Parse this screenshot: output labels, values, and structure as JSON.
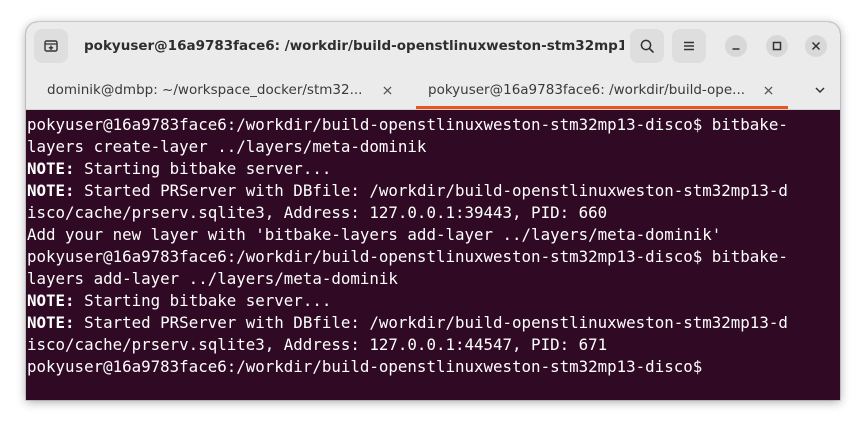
{
  "window": {
    "title": "pokyuser@16a9783face6: /workdir/build-openstlinuxweston-stm32mp13-..."
  },
  "tabs": [
    {
      "label": "dominik@dmbp: ~/workspace_docker/stm32...",
      "active": false
    },
    {
      "label": "pokyuser@16a9783face6: /workdir/build-ope...",
      "active": true
    }
  ],
  "colors": {
    "terminal_bg": "#300a24",
    "accent": "#e95420",
    "header_bg": "#ebebeb"
  },
  "icons": {
    "new_tab": "new-tab-icon",
    "search": "search-icon",
    "menu": "hamburger-menu-icon",
    "minimize": "minimize-icon",
    "maximize": "maximize-icon",
    "close": "close-icon",
    "tab_close": "tab-close-icon",
    "tab_list": "chevron-down-icon"
  },
  "terminal": {
    "lines": [
      {
        "prefix": "",
        "text": "pokyuser@16a9783face6:/workdir/build-openstlinuxweston-stm32mp13-disco$ bitbake-"
      },
      {
        "prefix": "",
        "text": "layers create-layer ../layers/meta-dominik"
      },
      {
        "prefix": "NOTE:",
        "text": " Starting bitbake server..."
      },
      {
        "prefix": "NOTE:",
        "text": " Started PRServer with DBfile: /workdir/build-openstlinuxweston-stm32mp13-d"
      },
      {
        "prefix": "",
        "text": "isco/cache/prserv.sqlite3, Address: 127.0.0.1:39443, PID: 660"
      },
      {
        "prefix": "",
        "text": "Add your new layer with 'bitbake-layers add-layer ../layers/meta-dominik'"
      },
      {
        "prefix": "",
        "text": "pokyuser@16a9783face6:/workdir/build-openstlinuxweston-stm32mp13-disco$ bitbake-"
      },
      {
        "prefix": "",
        "text": "layers add-layer ../layers/meta-dominik"
      },
      {
        "prefix": "NOTE:",
        "text": " Starting bitbake server..."
      },
      {
        "prefix": "NOTE:",
        "text": " Started PRServer with DBfile: /workdir/build-openstlinuxweston-stm32mp13-d"
      },
      {
        "prefix": "",
        "text": "isco/cache/prserv.sqlite3, Address: 127.0.0.1:44547, PID: 671"
      },
      {
        "prefix": "",
        "text": "pokyuser@16a9783face6:/workdir/build-openstlinuxweston-stm32mp13-disco$ "
      }
    ]
  }
}
